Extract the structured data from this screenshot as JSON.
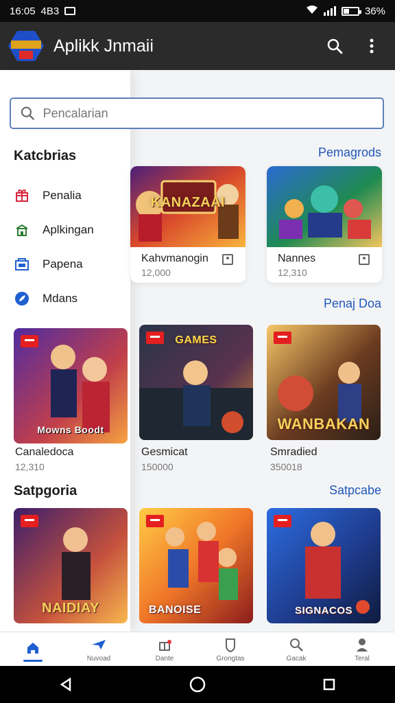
{
  "status": {
    "time": "16:05",
    "date": "4B3",
    "battery": "36%"
  },
  "app": {
    "title": "Aplikk Jnmaii"
  },
  "search": {
    "placeholder": "Pencalarian"
  },
  "drawer": {
    "heading": "Katcbrias",
    "items": [
      {
        "label": "Penalia",
        "icon": "gift-icon"
      },
      {
        "label": "Aplkingan",
        "icon": "store-icon"
      },
      {
        "label": "Papena",
        "icon": "folder-icon"
      },
      {
        "label": "Mdans",
        "icon": "rocket-icon"
      }
    ],
    "sub_heading": "Satpgoria"
  },
  "sections": {
    "top": {
      "link": "Pemagrods"
    },
    "middle": {
      "link": "Penaj Doa"
    },
    "bottom": {
      "link": "Satpcabe"
    }
  },
  "top_cards": [
    {
      "name": "Kahvmanogin",
      "subtitle": "12,000",
      "art_text": "KANAZAAI"
    },
    {
      "name": "Nannes",
      "subtitle": "12,310",
      "art_text": ""
    }
  ],
  "games_row_1": [
    {
      "name": "Canaledoca",
      "subtitle": "12,310",
      "overlay": "Mowns Boodt"
    },
    {
      "name": "Gesmicat",
      "subtitle": "150000",
      "overlay": "GAMES"
    },
    {
      "name": "Smradied",
      "subtitle": "350018",
      "overlay": "WANBAKAN"
    }
  ],
  "games_row_2": [
    {
      "name": "",
      "overlay": "NAIDIAY"
    },
    {
      "name": "",
      "overlay": "BANOISE"
    },
    {
      "name": "",
      "overlay": "SIGNACOS"
    }
  ],
  "bottom_nav": [
    {
      "label": "",
      "icon": "home-icon"
    },
    {
      "label": "Nuvoad",
      "icon": "plane-icon"
    },
    {
      "label": "Dante",
      "icon": "gift-icon"
    },
    {
      "label": "Grongtas",
      "icon": "shield-icon"
    },
    {
      "label": "Gacak",
      "icon": "search-icon"
    },
    {
      "label": "Teral",
      "icon": "profile-icon"
    }
  ],
  "colors": {
    "accent": "#1f5fd0",
    "app_bar": "#2b2b2b",
    "drawer": "#ffffff"
  }
}
